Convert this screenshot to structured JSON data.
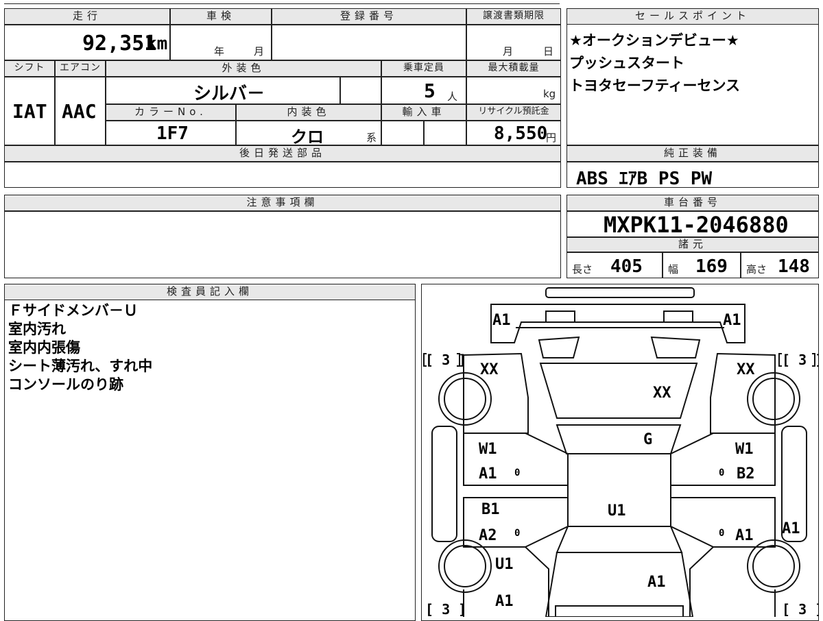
{
  "top_table": {
    "mileage_label": "走行",
    "mileage_value": "92,351",
    "mileage_unit": "km",
    "inspection_label": "車検",
    "inspection_year": "年",
    "inspection_month": "月",
    "registration_label": "登録番号",
    "transfer_label": "譲渡書類期限",
    "transfer_month": "月",
    "transfer_day": "日",
    "shift_label": "シフト",
    "shift_value": "IAT",
    "ac_label": "エアコン",
    "ac_value": "AAC",
    "exterior_label": "外装色",
    "exterior_value": "シルバ－",
    "capacity_label": "乗車定員",
    "capacity_value": "5",
    "capacity_unit": "人",
    "load_label": "最大積載量",
    "load_unit": "kg",
    "color_no_label": "カラーNo.",
    "color_no_value": "1F7",
    "interior_label": "内装色",
    "interior_value": "クロ",
    "interior_suffix": "系",
    "import_label": "輸入車",
    "recycle_label": "リサイクル預託金",
    "recycle_value": "8,550",
    "recycle_unit": "円",
    "later_parts_label": "後日発送部品"
  },
  "sales_points": {
    "label": "セールスポイント",
    "lines": [
      "★オークションデビュー★",
      "プッシュスタート",
      "トヨタセーフティーセンス"
    ]
  },
  "equipment": {
    "label": "純正装備",
    "value": "ABS ｴｱB PS PW"
  },
  "notes": {
    "label": "注意事項欄"
  },
  "chassis": {
    "label": "車台番号",
    "value": "MXPK11-2046880",
    "spec_label": "諸元",
    "length_label": "長さ",
    "length_value": "405",
    "width_label": "幅",
    "width_value": "169",
    "height_label": "高さ",
    "height_value": "148"
  },
  "inspector": {
    "label": "検査員記入欄",
    "lines": [
      "Ｆサイドメンバ－Ｕ",
      "室内汚れ",
      "室内内張傷",
      "シート薄汚れ、すれ中",
      "コンソールのり跡"
    ]
  },
  "diagram": {
    "front_left": "A1",
    "front_right": "A1",
    "tire_fl": "[ 3 ]",
    "tire_fr": "[ 3 ]",
    "tire_rl": "[ 3 ]",
    "tire_rr": "[ 3 ]",
    "fender_fl": "XX",
    "fender_fr": "XX",
    "hood": "XX",
    "windshield": "G",
    "roof": "U1",
    "door_fl_1": "W1",
    "door_fl_2": "A1",
    "door_fr_1": "W1",
    "door_fr_2": "B2",
    "door_rl_1": "B1",
    "door_rl_2": "A2",
    "door_rr": "A1",
    "sill_right": "A1",
    "quarter_rl": "U1",
    "quarter_rl_2": "A1",
    "trunk": "A1",
    "zero_1": "0",
    "zero_2": "0",
    "zero_3": "0",
    "zero_4": "0"
  }
}
